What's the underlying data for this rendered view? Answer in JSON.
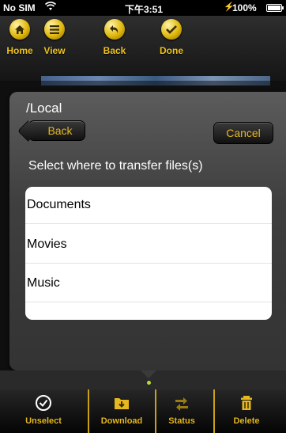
{
  "status_bar": {
    "carrier": "No SIM",
    "wifi_icon": "wifi-icon",
    "time": "下午3:51",
    "battery_percent": "100%",
    "battery_level": 1.0
  },
  "toolbar": {
    "items": [
      {
        "label": "Home",
        "icon": "home-icon"
      },
      {
        "label": "View",
        "icon": "list-icon"
      },
      {
        "label": "Back",
        "icon": "back-arrow-icon"
      },
      {
        "label": "Done",
        "icon": "checkmark-icon"
      }
    ]
  },
  "dialog": {
    "path": "/Local",
    "back_label": "Back",
    "cancel_label": "Cancel",
    "prompt": "Select where to transfer files(s)",
    "folders": [
      "Documents",
      "Movies",
      "Music"
    ]
  },
  "tabbar": {
    "items": [
      {
        "label": "Unselect",
        "icon": "unselect-check-icon"
      },
      {
        "label": "Download",
        "icon": "download-folder-icon"
      },
      {
        "label": "Status",
        "icon": "transfer-status-icon"
      },
      {
        "label": "Delete",
        "icon": "trash-icon"
      }
    ]
  },
  "colors": {
    "accent": "#e8b820",
    "background": "#1c1c1c",
    "list_background": "#ffffff"
  }
}
